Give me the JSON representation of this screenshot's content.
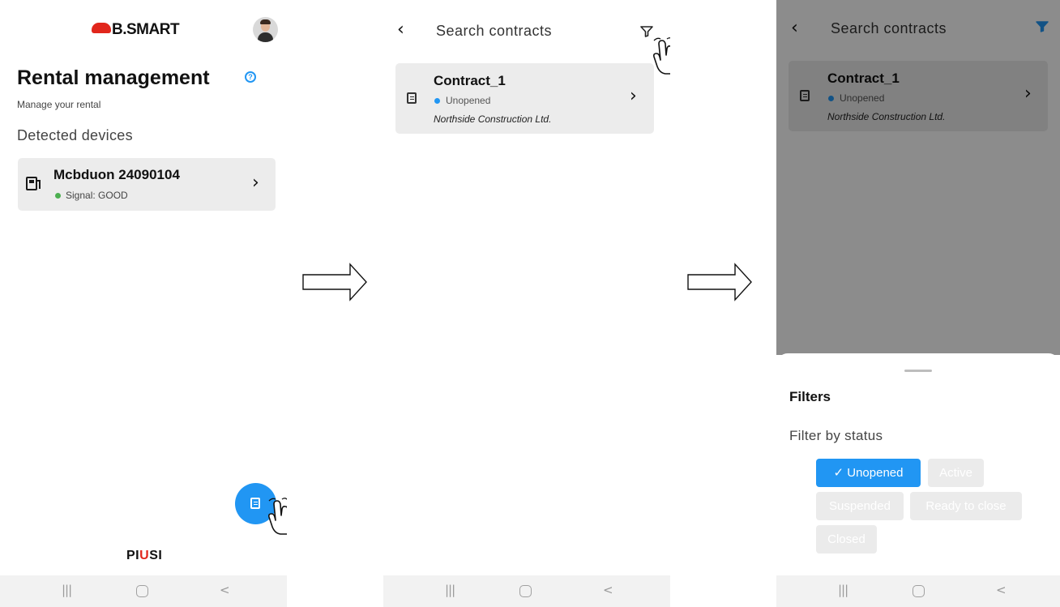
{
  "screen1": {
    "logo_text": "B.SMART",
    "title": "Rental management",
    "subtitle": "Manage your rental",
    "section_label": "Detected devices",
    "device": {
      "name": "Mcbduon 24090104",
      "signal": "Signal: GOOD",
      "signal_color": "#4caf50"
    },
    "footer_brand_a": "PI",
    "footer_brand_b": "U",
    "footer_brand_c": "SI",
    "accent": "#2196f3"
  },
  "screen2": {
    "header_title": "Search contracts",
    "contract": {
      "name": "Contract_1",
      "status": "Unopened",
      "status_color": "#2196f3",
      "company": "Northside Construction Ltd."
    }
  },
  "screen3": {
    "header_title": "Search contracts",
    "contract": {
      "name": "Contract_1",
      "status": "Unopened",
      "company": "Northside Construction Ltd."
    },
    "filters_title": "Filters",
    "filter_by_status": "Filter by status",
    "chips": [
      {
        "label": "Unopened",
        "selected": true
      },
      {
        "label": "Active",
        "selected": false
      },
      {
        "label": "Suspended",
        "selected": false
      },
      {
        "label": "Ready to close",
        "selected": false
      },
      {
        "label": "Closed",
        "selected": false
      }
    ],
    "check_mark": "✓"
  },
  "navbar": {
    "recent_glyph": "|||",
    "back_glyph": "<"
  },
  "icons": {
    "chevron_right": "›",
    "chevron_left": "‹"
  }
}
